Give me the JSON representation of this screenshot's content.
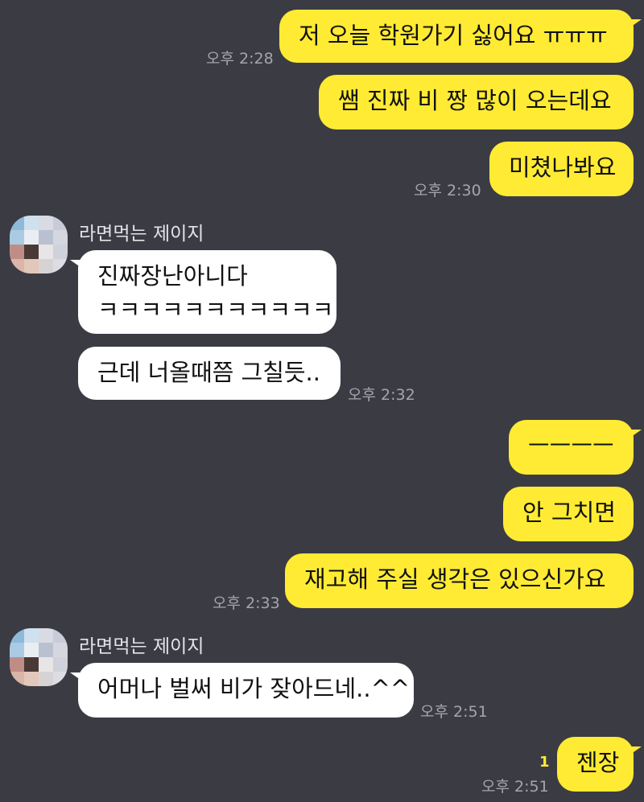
{
  "messages": [
    {
      "from": "me",
      "text": "저 오늘 학원가기 싫어요 ㅠㅠㅠ",
      "time": "오후 2:28"
    },
    {
      "from": "me",
      "text": "쌤 진짜 비 짱 많이 오는데요"
    },
    {
      "from": "me",
      "text": "미쳤나봐요",
      "time": "오후 2:30"
    },
    {
      "from": "them",
      "sender": "라면먹는 제이지",
      "text_line1": "진짜장난아니다",
      "text_line2": "ㅋㅋㅋㅋㅋㅋㅋㅋㅋㅋㅋ"
    },
    {
      "from": "them",
      "text": "근데 너올때쯤 그칠듯..",
      "time": "오후 2:32"
    },
    {
      "from": "me",
      "text": "ㅡㅡㅡㅡ"
    },
    {
      "from": "me",
      "text": "안 그치면"
    },
    {
      "from": "me",
      "text": "재고해 주실 생각은 있으신가요",
      "time": "오후 2:33"
    },
    {
      "from": "them",
      "sender": "라면먹는 제이지",
      "text": "어머나 벌써 비가 잦아드네..^^",
      "time": "오후 2:51"
    },
    {
      "from": "me",
      "text": "젠장",
      "time": "오후 2:51",
      "unread": "1"
    }
  ],
  "avatar_colors": [
    "#8fb9d9",
    "#cfe0ee",
    "#d8dbe3",
    "#c9ccd6",
    "#aacbe3",
    "#e9eef3",
    "#b9c1d1",
    "#d4d7df",
    "#c08d86",
    "#4a3a36",
    "#e8e5e6",
    "#cfd2da",
    "#d9b6a8",
    "#e2c7bb",
    "#d7d3d4",
    "#dcdde3"
  ],
  "colors": {
    "background": "#3b3b44",
    "my_bubble": "#ffeb33",
    "their_bubble": "#ffffff",
    "timestamp": "#a5a5ad"
  }
}
